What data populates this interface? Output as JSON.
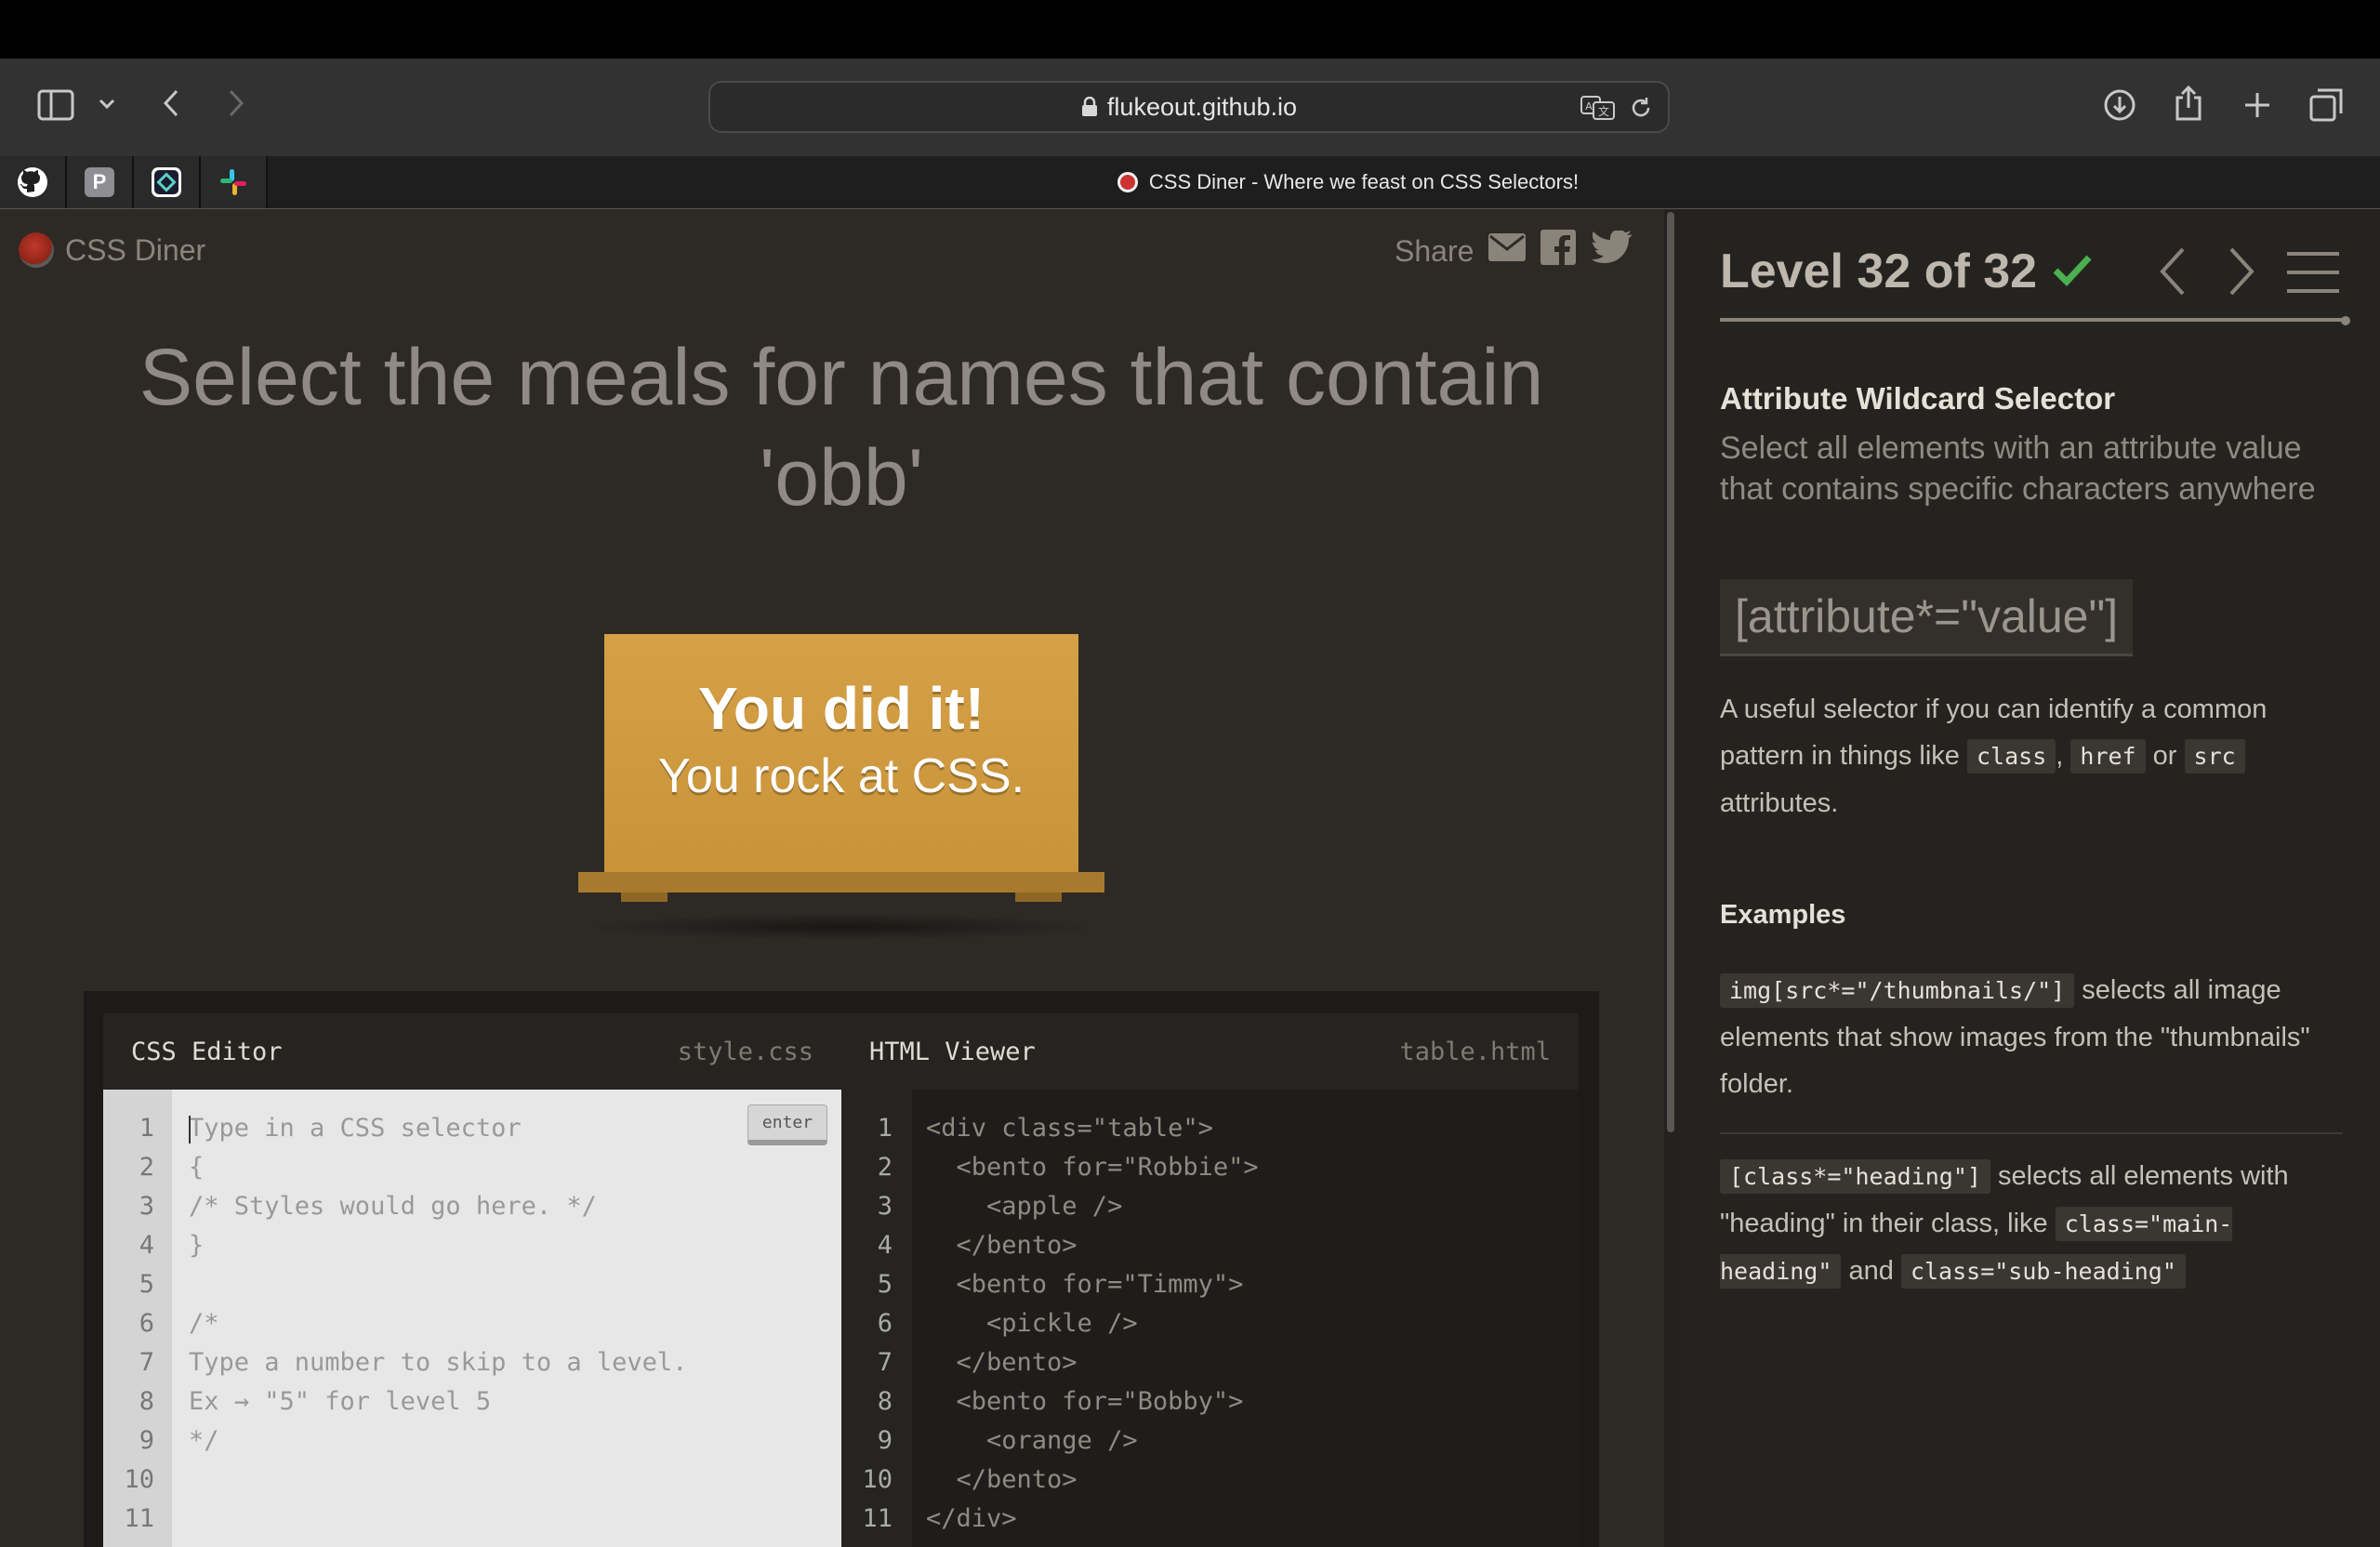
{
  "browser": {
    "url": "flukeout.github.io",
    "tab_title": "CSS Diner - Where we feast on CSS Selectors!"
  },
  "header": {
    "logo_text": "CSS Diner",
    "share_label": "Share"
  },
  "task": {
    "headline": "Select the meals for names that contain 'obb'"
  },
  "table": {
    "line1": "You did it!",
    "line2": "You rock at CSS."
  },
  "css_editor": {
    "title": "CSS Editor",
    "filename": "style.css",
    "enter_label": "enter",
    "placeholder": "Type in a CSS selector",
    "line_numbers": "1\n2\n3\n4\n5\n6\n7\n8\n9\n10\n11",
    "lines": "{\n/* Styles would go here. */\n}\n\n/*\nType a number to skip to a level.\nEx → \"5\" for level 5\n*/"
  },
  "html_viewer": {
    "title": "HTML Viewer",
    "filename": "table.html",
    "line_numbers": "1\n2\n3\n4\n5\n6\n7\n8\n9\n10\n11",
    "lines": "<div class=\"table\">\n  <bento for=\"Robbie\">\n    <apple />\n  </bento>\n  <bento for=\"Timmy\">\n    <pickle />\n  </bento>\n  <bento for=\"Bobby\">\n    <orange />\n  </bento>\n</div>"
  },
  "sidebar": {
    "level_label": "Level 32 of 32",
    "level_complete": true,
    "progress_fraction": 1.0,
    "selector_name": "Attribute Wildcard Selector",
    "selector_summary": "Select all elements with an attribute value that contains specific characters anywhere",
    "syntax": "[attribute*=\"value\"]",
    "desc_before": "A useful selector if you can identify a common pattern in things like",
    "desc_code1": "class",
    "desc_comma": ",",
    "desc_code2": "href",
    "desc_or": "or",
    "desc_code3": "src",
    "desc_after": "attributes.",
    "examples_heading": "Examples",
    "ex1_code": "img[src*=\"/thumbnails/\"]",
    "ex1_text": "selects all image elements that show images from the \"thumbnails\" folder.",
    "ex2_code": "[class*=\"heading\"]",
    "ex2_text1": "selects all elements with \"heading\" in their class, like",
    "ex2_code2": "class=\"main-heading\"",
    "ex2_and": "and",
    "ex2_code3": "class=\"sub-heading\""
  },
  "colors": {
    "accent_check": "#4caf50",
    "table_wood": "#d5a046",
    "background": "#2d2a26"
  }
}
